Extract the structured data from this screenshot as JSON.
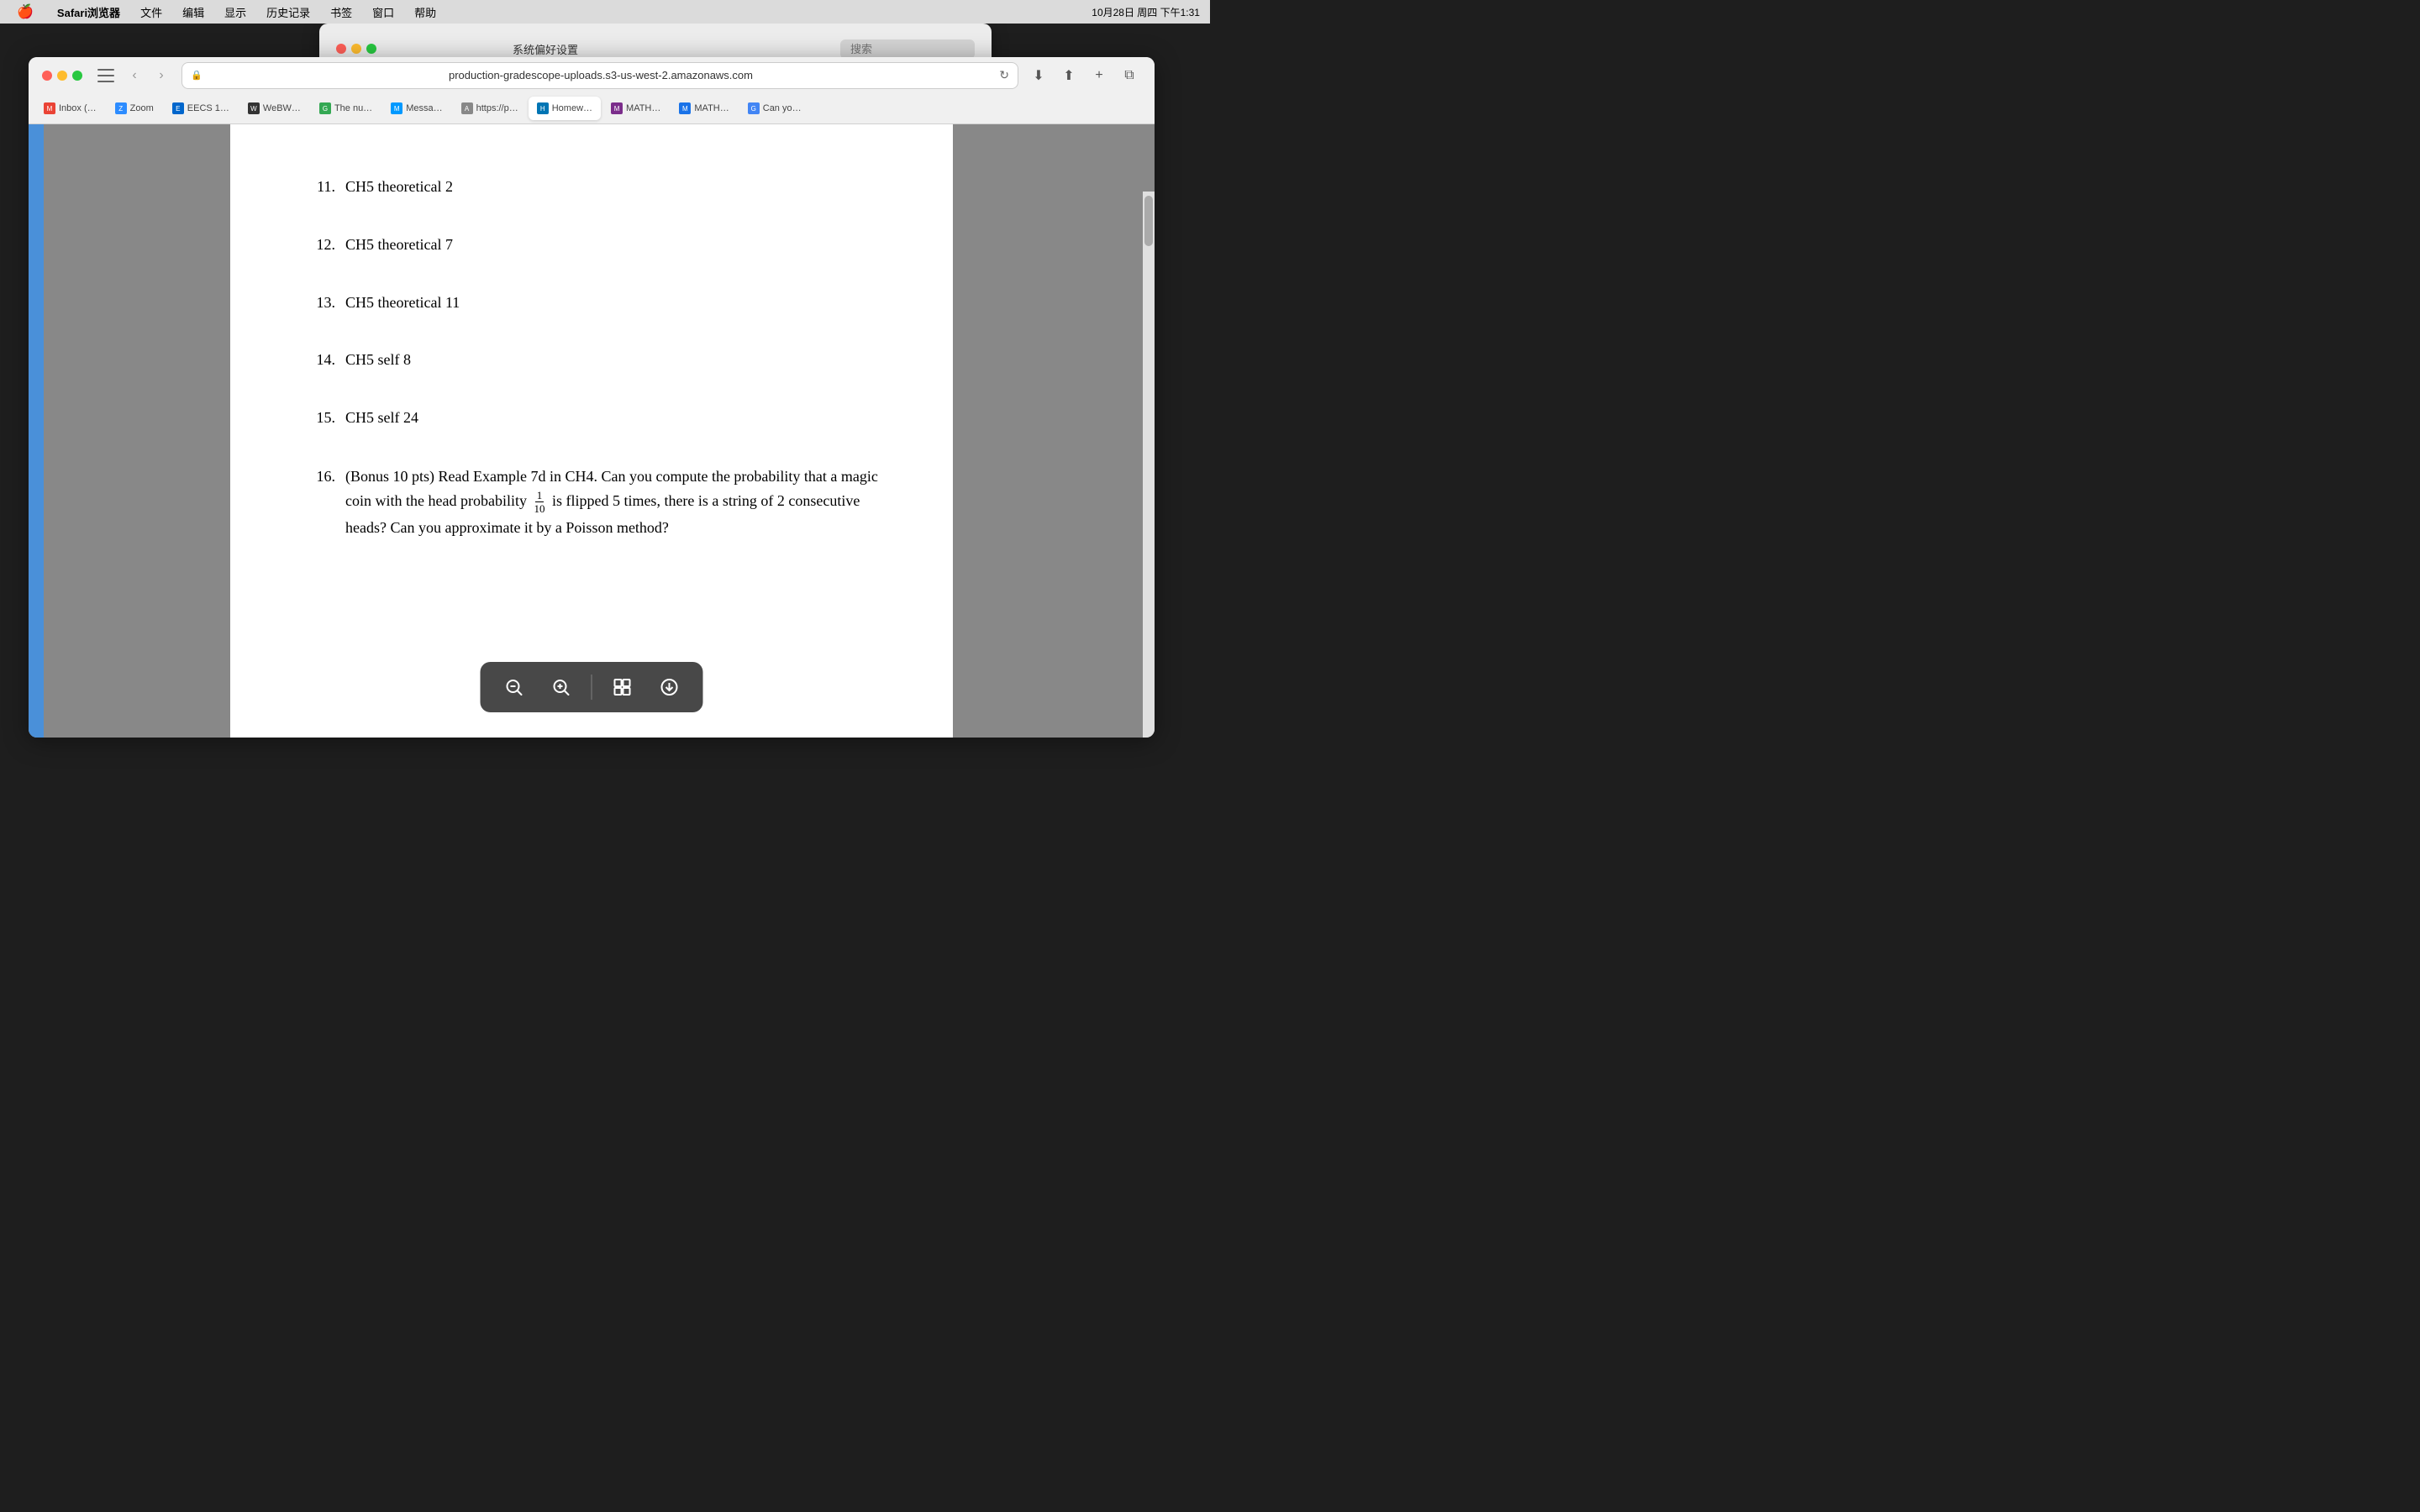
{
  "menubar": {
    "apple": "🍎",
    "app_name": "Safari浏览器",
    "menus": [
      "文件",
      "编辑",
      "显示",
      "历史记录",
      "书签",
      "窗口",
      "帮助"
    ],
    "right_items": [
      "wifi-icon",
      "datetime",
      "battery"
    ],
    "datetime": "10月28日 周四 下午1:31"
  },
  "sysprefs": {
    "title": "系统偏好设置",
    "search_placeholder": "搜索"
  },
  "safari": {
    "address": "production-gradescope-uploads.s3-us-west-2.amazonaws.com",
    "tabs": [
      {
        "id": "gmail",
        "favicon": "M",
        "label": "Inbox (…",
        "favicon_type": "gmail"
      },
      {
        "id": "zoom",
        "favicon": "Z",
        "label": "Zoom",
        "favicon_type": "zoom"
      },
      {
        "id": "eecs",
        "favicon": "E",
        "label": "EECS 1…",
        "favicon_type": "eecs"
      },
      {
        "id": "webwork",
        "favicon": "W",
        "label": "WeBW…",
        "favicon_type": "webwork"
      },
      {
        "id": "google",
        "favicon": "G",
        "label": "The nu…",
        "favicon_type": "green"
      },
      {
        "id": "messenger",
        "favicon": "M",
        "label": "Messa…",
        "favicon_type": "messenger"
      },
      {
        "id": "https",
        "favicon": "A",
        "label": "https://p…",
        "favicon_type": "gray"
      },
      {
        "id": "gradescope",
        "favicon": "H",
        "label": "Homew…",
        "favicon_type": "gradescope"
      },
      {
        "id": "mathpix1",
        "favicon": "M",
        "label": "MATH…",
        "favicon_type": "mathpix"
      },
      {
        "id": "chart",
        "favicon": "M",
        "label": "MATH…",
        "favicon_type": "chart"
      },
      {
        "id": "google2",
        "favicon": "G",
        "label": "Can yo…",
        "favicon_type": "google"
      }
    ]
  },
  "pdf": {
    "items": [
      {
        "number": "11.",
        "text": "CH5 theoretical 2"
      },
      {
        "number": "12.",
        "text": "CH5 theoretical 7"
      },
      {
        "number": "13.",
        "text": "CH5 theoretical 11"
      },
      {
        "number": "14.",
        "text": "CH5 self 8"
      },
      {
        "number": "15.",
        "text": "CH5 self 24"
      },
      {
        "number": "16.",
        "text_before": "(Bonus 10 pts) Read Example 7d in CH4.  Can you compute the probability that a magic coin with the head probability ",
        "fraction_num": "1",
        "fraction_den": "10",
        "text_after": " is flipped 5 times, there is a string of 2 consecutive heads?  Can you approximate it by a Poisson method?",
        "is_special": true
      }
    ],
    "toolbar_buttons": [
      {
        "id": "zoom-out",
        "symbol": "−",
        "title": "Zoom Out"
      },
      {
        "id": "zoom-in",
        "symbol": "+",
        "title": "Zoom In"
      },
      {
        "id": "thumbnail",
        "symbol": "⊞",
        "title": "Thumbnails"
      },
      {
        "id": "download",
        "symbol": "↓",
        "title": "Download"
      }
    ]
  }
}
